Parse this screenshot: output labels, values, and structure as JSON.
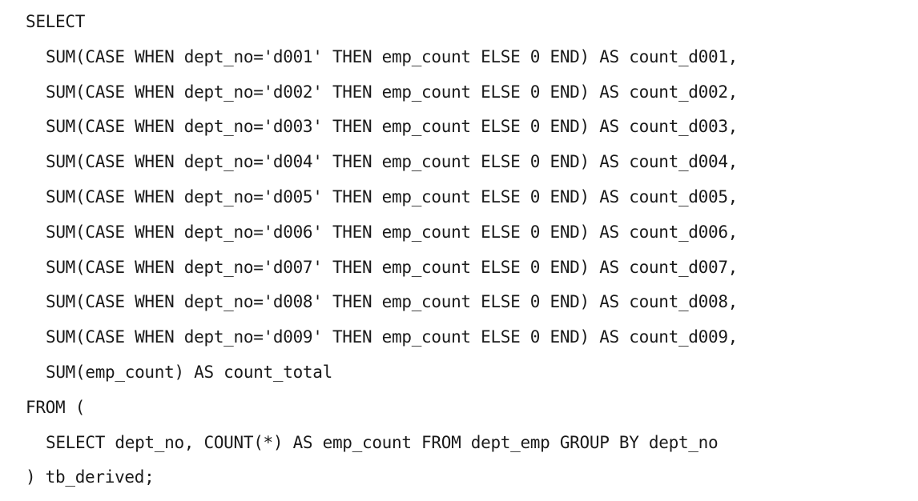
{
  "code": {
    "lines": [
      {
        "text": "SELECT",
        "indent": 0
      },
      {
        "text": "SUM(CASE WHEN dept_no='d001' THEN emp_count ELSE 0 END) AS count_d001,",
        "indent": 1
      },
      {
        "text": "SUM(CASE WHEN dept_no='d002' THEN emp_count ELSE 0 END) AS count_d002,",
        "indent": 1
      },
      {
        "text": "SUM(CASE WHEN dept_no='d003' THEN emp_count ELSE 0 END) AS count_d003,",
        "indent": 1
      },
      {
        "text": "SUM(CASE WHEN dept_no='d004' THEN emp_count ELSE 0 END) AS count_d004,",
        "indent": 1
      },
      {
        "text": "SUM(CASE WHEN dept_no='d005' THEN emp_count ELSE 0 END) AS count_d005,",
        "indent": 1
      },
      {
        "text": "SUM(CASE WHEN dept_no='d006' THEN emp_count ELSE 0 END) AS count_d006,",
        "indent": 1
      },
      {
        "text": "SUM(CASE WHEN dept_no='d007' THEN emp_count ELSE 0 END) AS count_d007,",
        "indent": 1
      },
      {
        "text": "SUM(CASE WHEN dept_no='d008' THEN emp_count ELSE 0 END) AS count_d008,",
        "indent": 1
      },
      {
        "text": "SUM(CASE WHEN dept_no='d009' THEN emp_count ELSE 0 END) AS count_d009,",
        "indent": 1
      },
      {
        "text": "SUM(emp_count) AS count_total",
        "indent": 1
      },
      {
        "text": "FROM (",
        "indent": 0
      },
      {
        "text": "SELECT dept_no, COUNT(*) AS emp_count FROM dept_emp GROUP BY dept_no",
        "indent": 1
      },
      {
        "text": ") tb_derived;",
        "indent": 0
      }
    ]
  }
}
